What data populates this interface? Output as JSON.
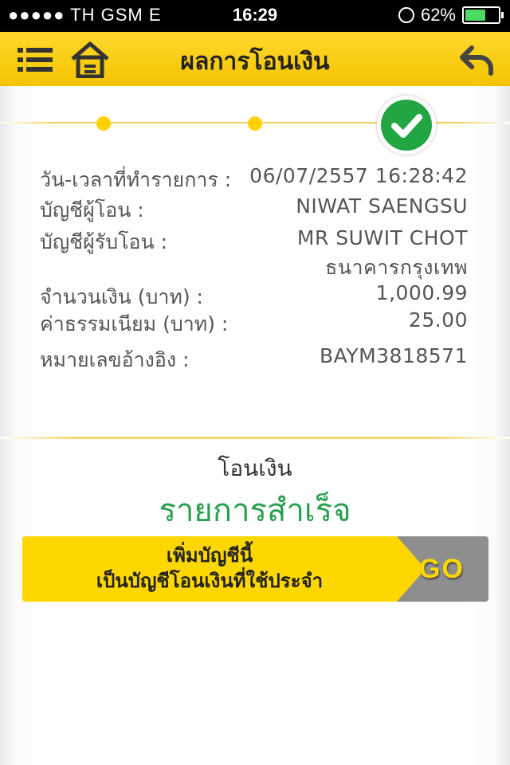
{
  "status_bar": {
    "carrier": "●●●●● TH GSM   E",
    "time": "16:29",
    "battery": "62%"
  },
  "header": {
    "title": "ผลการโอนเงิน"
  },
  "details": [
    {
      "label": "วัน-เวลาที่ทำรายการ :",
      "value": "06/07/2557 16:28:42"
    },
    {
      "label": "บัญชีผู้โอน :",
      "value": "NIWAT SAENGSU"
    },
    {
      "label": "บัญชีผู้รับโอน :",
      "value": "MR SUWIT CHOT",
      "value2": "ธนาคารกรุงเทพ"
    },
    {
      "label": "จำนวนเงิน (บาท) :",
      "value": "1,000.99"
    },
    {
      "label": "ค่าธรรมเนียม (บาท) :",
      "value": "25.00"
    },
    {
      "label": "หมายเลขอ้างอิง :",
      "value": "BAYM3818571"
    }
  ],
  "result": {
    "label": "โอนเงิน",
    "status": "รายการสำเร็จ"
  },
  "favorite_button": {
    "line1": "เพิ่มบัญชีนี้",
    "line2": "เป็นบัญชีโอนเงินที่ใช้ประจำ",
    "go_label": "GO"
  },
  "colors": {
    "brand_yellow": "#ffd700",
    "success_green": "#28a050",
    "check_green": "#21a642"
  },
  "icons": [
    "menu-icon",
    "home-icon",
    "back-icon",
    "check-icon",
    "alarm-icon",
    "battery-icon"
  ]
}
